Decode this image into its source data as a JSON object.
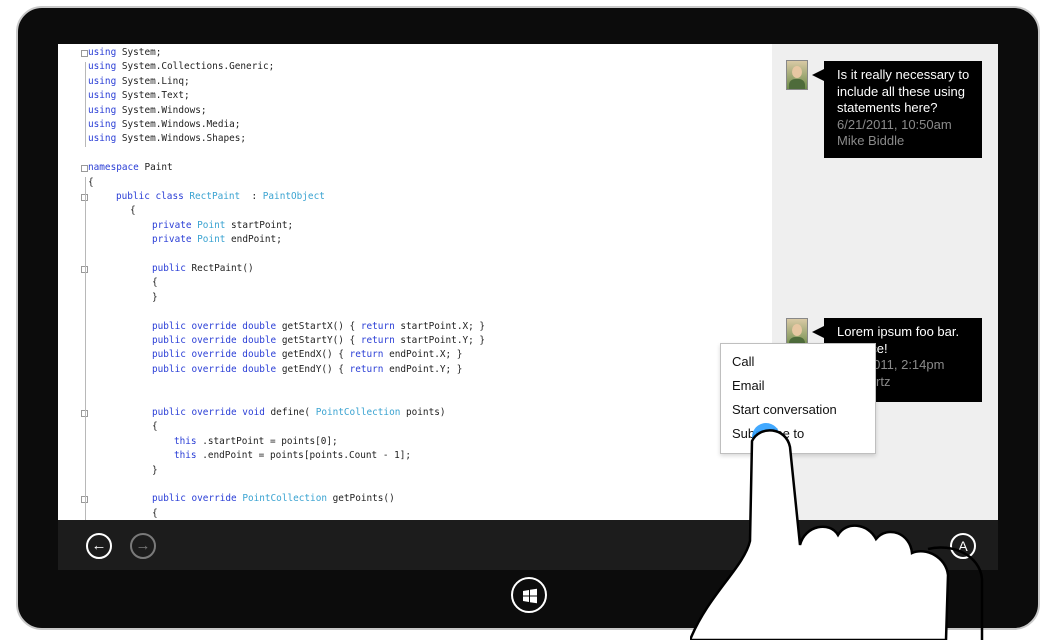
{
  "code": {
    "lines": [
      {
        "row": 0,
        "indent": 8,
        "parts": [
          [
            "kw",
            "using"
          ],
          [
            "",
            "System;"
          ]
        ]
      },
      {
        "row": 1,
        "indent": 8,
        "parts": [
          [
            "kw",
            "using"
          ],
          [
            "",
            "System.Collections.Generic;"
          ]
        ]
      },
      {
        "row": 2,
        "indent": 8,
        "parts": [
          [
            "kw",
            "using"
          ],
          [
            "",
            "System.Linq;"
          ]
        ]
      },
      {
        "row": 3,
        "indent": 8,
        "parts": [
          [
            "kw",
            "using"
          ],
          [
            "",
            "System.Text;"
          ]
        ]
      },
      {
        "row": 4,
        "indent": 8,
        "parts": [
          [
            "kw",
            "using"
          ],
          [
            "",
            "System.Windows;"
          ]
        ]
      },
      {
        "row": 5,
        "indent": 8,
        "parts": [
          [
            "kw",
            "using"
          ],
          [
            "",
            "System.Windows.Media;"
          ]
        ]
      },
      {
        "row": 6,
        "indent": 8,
        "parts": [
          [
            "kw",
            "using"
          ],
          [
            "",
            "System.Windows.Shapes;"
          ]
        ]
      },
      {
        "row": 8,
        "indent": 8,
        "parts": [
          [
            "kw",
            "namespace"
          ],
          [
            "",
            "Paint"
          ]
        ]
      },
      {
        "row": 9,
        "indent": 8,
        "parts": [
          [
            "",
            "{"
          ]
        ]
      },
      {
        "row": 10,
        "indent": 36,
        "parts": [
          [
            "kw",
            "public class"
          ],
          [
            "ty",
            "RectPaint"
          ],
          [
            "",
            " :"
          ],
          [
            "ty",
            "PaintObject"
          ]
        ]
      },
      {
        "row": 11,
        "indent": 50,
        "parts": [
          [
            "",
            "{"
          ]
        ]
      },
      {
        "row": 12,
        "indent": 72,
        "parts": [
          [
            "kw",
            "private"
          ],
          [
            "ty",
            "Point"
          ],
          [
            "",
            "startPoint;"
          ]
        ]
      },
      {
        "row": 13,
        "indent": 72,
        "parts": [
          [
            "kw",
            "private"
          ],
          [
            "ty",
            "Point"
          ],
          [
            "",
            "endPoint;"
          ]
        ]
      },
      {
        "row": 15,
        "indent": 72,
        "parts": [
          [
            "kw",
            "public"
          ],
          [
            "",
            "RectPaint()"
          ]
        ]
      },
      {
        "row": 16,
        "indent": 72,
        "parts": [
          [
            "",
            "{"
          ]
        ]
      },
      {
        "row": 17,
        "indent": 72,
        "parts": [
          [
            "",
            "}"
          ]
        ]
      },
      {
        "row": 19,
        "indent": 72,
        "parts": [
          [
            "kw",
            "public override double"
          ],
          [
            "",
            "getStartX() {"
          ],
          [
            "kw",
            "return"
          ],
          [
            "",
            "startPoint.X; }"
          ]
        ]
      },
      {
        "row": 20,
        "indent": 72,
        "parts": [
          [
            "kw",
            "public override double"
          ],
          [
            "",
            "getStartY() {"
          ],
          [
            "kw",
            "return"
          ],
          [
            "",
            "startPoint.Y; }"
          ]
        ]
      },
      {
        "row": 21,
        "indent": 72,
        "parts": [
          [
            "kw",
            "public override double"
          ],
          [
            "",
            "getEndX() {"
          ],
          [
            "kw",
            "return"
          ],
          [
            "",
            "endPoint.X; }"
          ]
        ]
      },
      {
        "row": 22,
        "indent": 72,
        "parts": [
          [
            "kw",
            "public override double"
          ],
          [
            "",
            "getEndY() {"
          ],
          [
            "kw",
            "return"
          ],
          [
            "",
            "endPoint.Y; }"
          ]
        ]
      },
      {
        "row": 25,
        "indent": 72,
        "parts": [
          [
            "kw",
            "public override void"
          ],
          [
            "",
            "define("
          ],
          [
            "ty",
            "PointCollection"
          ],
          [
            "",
            "points)"
          ]
        ]
      },
      {
        "row": 26,
        "indent": 72,
        "parts": [
          [
            "",
            "{"
          ]
        ]
      },
      {
        "row": 27,
        "indent": 94,
        "parts": [
          [
            "kw",
            "this"
          ],
          [
            "",
            ".startPoint = points[0];"
          ]
        ]
      },
      {
        "row": 28,
        "indent": 94,
        "parts": [
          [
            "kw",
            "this"
          ],
          [
            "",
            ".endPoint = points[points.Count - 1];"
          ]
        ]
      },
      {
        "row": 29,
        "indent": 72,
        "parts": [
          [
            "",
            "}"
          ]
        ]
      },
      {
        "row": 31,
        "indent": 72,
        "parts": [
          [
            "kw",
            "public override"
          ],
          [
            "ty",
            "PointCollection"
          ],
          [
            "",
            "getPoints()"
          ]
        ]
      },
      {
        "row": 32,
        "indent": 72,
        "parts": [
          [
            "",
            "{"
          ]
        ]
      }
    ]
  },
  "comments": [
    {
      "text": "Is it really necessary to include all these using statements here?",
      "date": "6/21/2011, 10:50am",
      "author": "Mike Biddle"
    },
    {
      "text": "Lorem ipsum foo bar. Practice!",
      "date": "6/21/2011, 2:14pm",
      "author": "Schwartz"
    }
  ],
  "appbar": {
    "back_glyph": "←",
    "forward_glyph": "→",
    "account_glyph": "A"
  },
  "context_menu": {
    "items": [
      "Call",
      "Email",
      "Start conversation",
      "Subscribe to"
    ]
  },
  "colors": {
    "keyword": "#2a3ed6",
    "type": "#3aa3d1",
    "touch": "#2da0ff",
    "bezel": "#0c0c0c"
  },
  "icons": {
    "windows": "windows-logo-icon",
    "back": "back-arrow-icon",
    "forward": "forward-arrow-icon"
  }
}
